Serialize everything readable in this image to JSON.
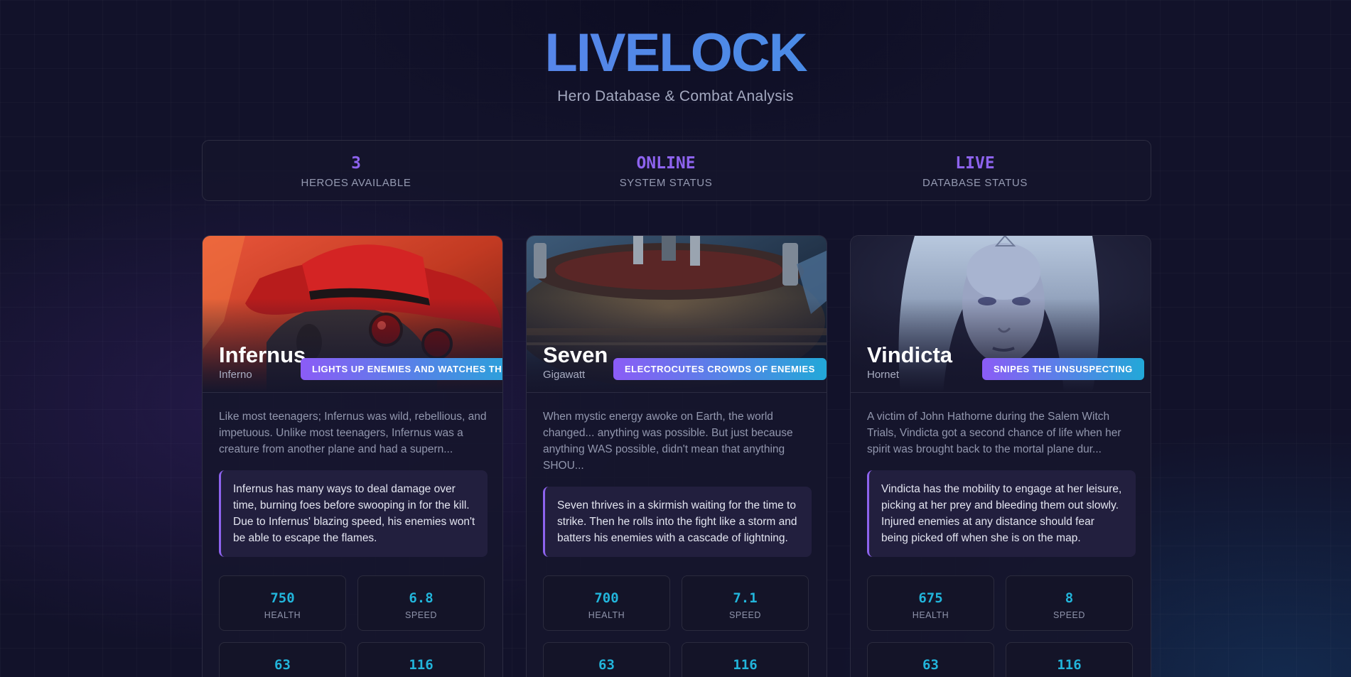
{
  "header": {
    "title": "LIVELOCK",
    "subtitle": "Hero Database & Combat Analysis"
  },
  "stats": [
    {
      "value": "3",
      "label": "HEROES AVAILABLE"
    },
    {
      "value": "ONLINE",
      "label": "SYSTEM STATUS"
    },
    {
      "value": "LIVE",
      "label": "DATABASE STATUS"
    }
  ],
  "heroes": [
    {
      "name": "Infernus",
      "alias": "Inferno",
      "tag": "LIGHTS UP ENEMIES AND WATCHES THEM",
      "lore": "Like most teenagers; Infernus was wild, rebellious, and impetuous. Unlike most teenagers, Infernus was a creature from another plane and had a supern...",
      "playstyle": "Infernus has many ways to deal damage over time, burning foes before swooping in for the kill. Due to Infernus' blazing speed, his enemies won't be able to escape the flames.",
      "metrics": [
        {
          "value": "750",
          "label": "HEALTH"
        },
        {
          "value": "6.8",
          "label": "SPEED"
        },
        {
          "value": "63",
          "label": ""
        },
        {
          "value": "116",
          "label": ""
        }
      ]
    },
    {
      "name": "Seven",
      "alias": "Gigawatt",
      "tag": "ELECTROCUTES CROWDS OF ENEMIES",
      "lore": "When mystic energy awoke on Earth, the world changed... anything was possible. But just because anything WAS possible, didn't mean that anything SHOU...",
      "playstyle": "Seven thrives in a skirmish waiting for the time to strike. Then he rolls into the fight like a storm and batters his enemies with a cascade of lightning.",
      "metrics": [
        {
          "value": "700",
          "label": "HEALTH"
        },
        {
          "value": "7.1",
          "label": "SPEED"
        },
        {
          "value": "63",
          "label": ""
        },
        {
          "value": "116",
          "label": ""
        }
      ]
    },
    {
      "name": "Vindicta",
      "alias": "Hornet",
      "tag": "SNIPES THE UNSUSPECTING",
      "lore": "A victim of John Hathorne during the Salem Witch Trials, Vindicta got a second chance of life when her spirit was brought back to the mortal plane dur...",
      "playstyle": "Vindicta has the mobility to engage at her leisure, picking at her prey and bleeding them out slowly. Injured enemies at any distance should fear being picked off when she is on the map.",
      "metrics": [
        {
          "value": "675",
          "label": "HEALTH"
        },
        {
          "value": "8",
          "label": "SPEED"
        },
        {
          "value": "63",
          "label": ""
        },
        {
          "value": "116",
          "label": ""
        }
      ]
    }
  ],
  "colors": {
    "accent_purple": "#8d63ee",
    "accent_cyan": "#22b5db",
    "background": "#12122a"
  }
}
